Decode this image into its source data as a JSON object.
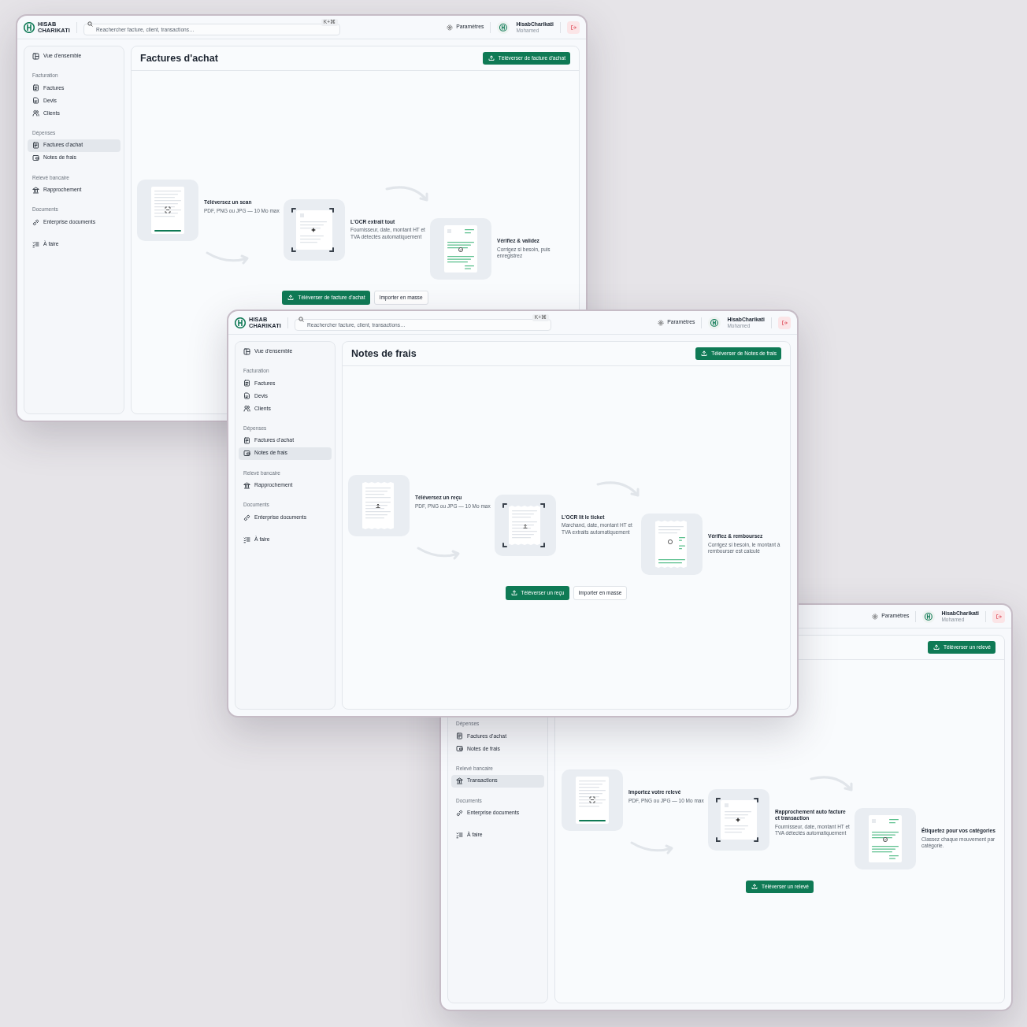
{
  "windows": [
    {
      "header": {
        "logo_lines": [
          "HISAB",
          "CHARIKATI"
        ],
        "search": {
          "placeholder": "Reachercher facture, client, transactions…",
          "shortcut": "K+⌘"
        },
        "settings": "Paramètres",
        "user": {
          "name": "HisabCharikati",
          "subtitle": "Mohamed"
        }
      },
      "sidebar": {
        "sections": [
          {
            "items": [
              {
                "label": "Vue d'ensemble",
                "kind": "overview",
                "selected": false
              }
            ]
          },
          {
            "label": "Facturation",
            "items": [
              {
                "label": "Factures",
                "kind": "invoice",
                "selected": false
              },
              {
                "label": "Devis",
                "kind": "quote",
                "selected": false
              },
              {
                "label": "Clients",
                "kind": "clients",
                "selected": false
              }
            ]
          },
          {
            "label": "Dépenses",
            "items": [
              {
                "label": "Factures d'achat",
                "kind": "purchase",
                "selected": true
              },
              {
                "label": "Notes de frais",
                "kind": "expense",
                "selected": false
              }
            ]
          },
          {
            "label": "Relevé bancaire",
            "items": [
              {
                "label": "Rapprochement",
                "kind": "bank",
                "selected": false
              }
            ]
          },
          {
            "label": "Documents",
            "items": [
              {
                "label": "Enterprise documents",
                "kind": "documents",
                "selected": false
              }
            ]
          },
          {
            "items": [
              {
                "label": "À faire",
                "kind": "todo",
                "selected": false
              }
            ]
          }
        ]
      },
      "main": {
        "title": "Factures d'achat",
        "header_button": "Téléverser de facture d'achat",
        "steps": [
          {
            "kind": "upload",
            "title": "Téléversez un scan",
            "text": "PDF, PNG ou JPG — 10 Mo max"
          },
          {
            "kind": "ocr",
            "title": "L'OCR extrait tout",
            "text": "Fournisseur, date, montant HT et TVA détectés automatiquement"
          },
          {
            "kind": "validate",
            "title": "Vérifiez & validez",
            "text": "Corrigez si besoin, puis enregistrez"
          }
        ],
        "buttons": [
          {
            "label": "Téléverser de facture d'achat",
            "kind": "primary"
          },
          {
            "label": "Importer en masse",
            "kind": "secondary"
          }
        ]
      }
    },
    {
      "header": {
        "logo_lines": [
          "HISAB",
          "CHARIKATI"
        ],
        "search": {
          "placeholder": "Reachercher facture, client, transactions…",
          "shortcut": "K+⌘"
        },
        "settings": "Paramètres",
        "user": {
          "name": "HisabCharikati",
          "subtitle": "Mohamed"
        }
      },
      "sidebar": {
        "sections": [
          {
            "items": [
              {
                "label": "Vue d'ensemble",
                "kind": "overview",
                "selected": false
              }
            ]
          },
          {
            "label": "Facturation",
            "items": [
              {
                "label": "Factures",
                "kind": "invoice",
                "selected": false
              },
              {
                "label": "Devis",
                "kind": "quote",
                "selected": false
              },
              {
                "label": "Clients",
                "kind": "clients",
                "selected": false
              }
            ]
          },
          {
            "label": "Dépenses",
            "items": [
              {
                "label": "Factures d'achat",
                "kind": "purchase",
                "selected": false
              },
              {
                "label": "Notes de frais",
                "kind": "expense",
                "selected": true
              }
            ]
          },
          {
            "label": "Relevé bancaire",
            "items": [
              {
                "label": "Rapprochement",
                "kind": "bank",
                "selected": false
              }
            ]
          },
          {
            "label": "Documents",
            "items": [
              {
                "label": "Enterprise documents",
                "kind": "documents",
                "selected": false
              }
            ]
          },
          {
            "items": [
              {
                "label": "À faire",
                "kind": "todo",
                "selected": false
              }
            ]
          }
        ]
      },
      "main": {
        "title": "Notes de frais",
        "header_button": "Téléverser de Notes de frais",
        "steps": [
          {
            "kind": "receipt",
            "title": "Téléversez un reçu",
            "text": "PDF, PNG ou JPG — 10 Mo max"
          },
          {
            "kind": "receiptocr",
            "title": "L'OCR lit le ticket",
            "text": "Marchand, date, montant HT et TVA extraits automatiquement"
          },
          {
            "kind": "refund",
            "title": "Vérifiez & remboursez",
            "text": "Corrigez si besoin, le montant à rembourser est calculé"
          }
        ],
        "buttons": [
          {
            "label": "Téléverser un reçu",
            "kind": "primary"
          },
          {
            "label": "Importer en masse",
            "kind": "secondary"
          }
        ]
      }
    },
    {
      "header": {
        "settings": "Paramètres",
        "user": {
          "name": "HisabCharikati",
          "subtitle": "Mohamed"
        }
      },
      "sidebar": {
        "sections": [
          {
            "label": "Dépenses",
            "items": [
              {
                "label": "Factures d'achat",
                "kind": "purchase",
                "selected": false
              },
              {
                "label": "Notes de frais",
                "kind": "expense",
                "selected": false
              }
            ]
          },
          {
            "label": "Relevé bancaire",
            "items": [
              {
                "label": "Transactions",
                "kind": "bank",
                "selected": true
              }
            ]
          },
          {
            "label": "Documents",
            "items": [
              {
                "label": "Enterprise documents",
                "kind": "documents",
                "selected": false
              }
            ]
          },
          {
            "items": [
              {
                "label": "À faire",
                "kind": "todo",
                "selected": false
              }
            ]
          }
        ]
      },
      "main": {
        "header_button": "Téléverser un relevé",
        "steps": [
          {
            "kind": "upload",
            "title": "Importez votre relevé",
            "text": "PDF, PNG ou JPG — 10 Mo max"
          },
          {
            "kind": "ocr",
            "title": "Rapprochement auto facture et transaction",
            "text": "Fournisseur, date, montant HT et TVA détectés automatiquement"
          },
          {
            "kind": "validate",
            "title": "Étiquetez pour vos catégories",
            "text": "Classez chaque mouvement par catégorie."
          }
        ],
        "buttons": [
          {
            "label": "Téléverser un relevé",
            "kind": "primary"
          }
        ]
      }
    }
  ]
}
